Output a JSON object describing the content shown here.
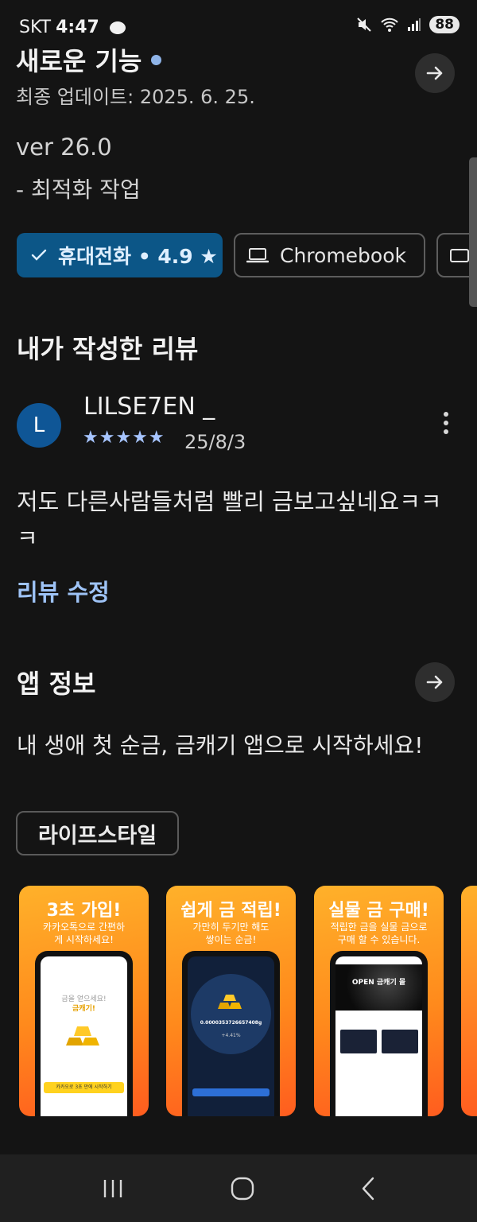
{
  "status_bar": {
    "carrier": "SKT",
    "time": "4:47",
    "battery": "88"
  },
  "whats_new": {
    "title": "새로운 기능",
    "updated": "최종 업데이트: 2025. 6. 25.",
    "version": "ver 26.0",
    "notes": "- 최적화 작업"
  },
  "devices": {
    "phone": "휴대전화 • 4.9 ★",
    "chromebook": "Chromebook"
  },
  "review": {
    "section_title": "내가 작성한 리뷰",
    "avatar_letter": "L",
    "reviewer": "LILSE7EN _",
    "stars": "★★★★★",
    "rating": 5,
    "date": "25/8/3",
    "text": "저도 다른사람들처럼 빨리 금보고싶네요ㅋㅋㅋ",
    "edit_label": "리뷰 수정"
  },
  "app_info": {
    "section_title": "앱 정보",
    "tagline": "내 생애 첫 순금, 금캐기 앱으로 시작하세요!",
    "category": "라이프스타일"
  },
  "screenshots": [
    {
      "title": "3초 가입!",
      "subtitle": "카카오톡으로 간편하게 시작하세요!",
      "screen_text_1": "금을 얻으세요!",
      "screen_text_2": "금캐기!",
      "button_text": "카카오로 3초 만에 시작하기"
    },
    {
      "title": "쉽게 금 적립!",
      "subtitle": "가만히 두기만 해도 쌓이는 순금!",
      "counter": "0.0000353726657408g",
      "rate": "+4.41%"
    },
    {
      "title": "실물 금 구매!",
      "subtitle": "적립한 금을 실물 금으로 구매 할 수 있습니다.",
      "banner": "OPEN 금캐기 몰"
    }
  ]
}
